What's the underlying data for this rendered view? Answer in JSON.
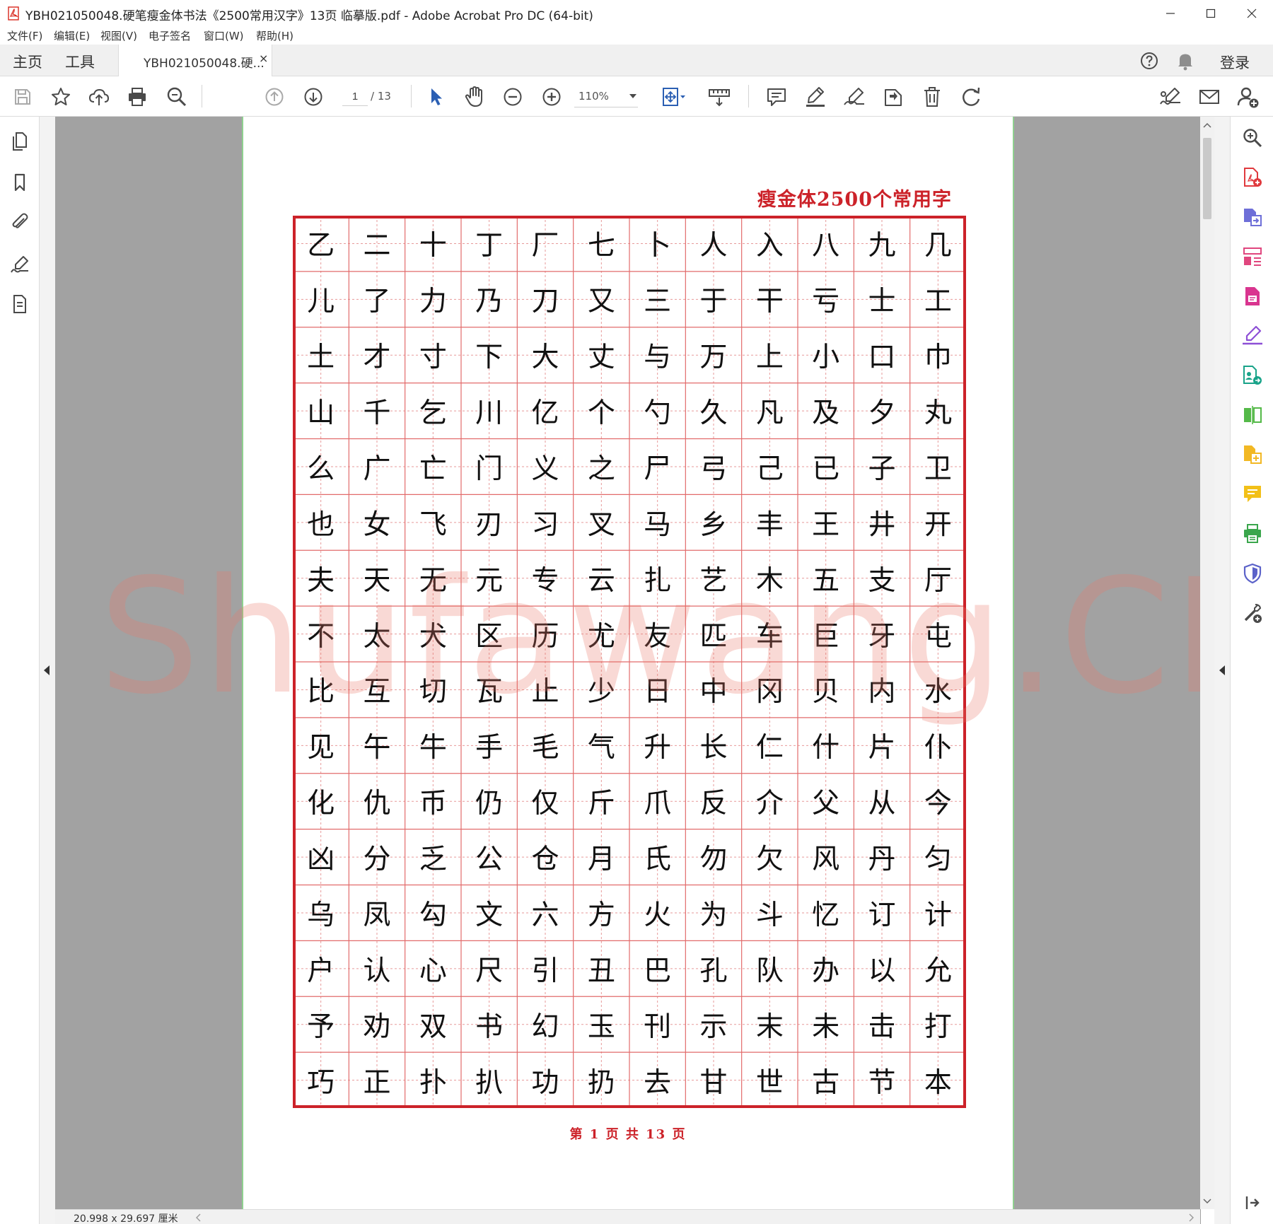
{
  "window": {
    "title": "YBH021050048.硬笔瘦金体书法《2500常用汉字》13页 临摹版.pdf - Adobe Acrobat Pro DC (64-bit)",
    "controls": [
      "minimize",
      "maximize",
      "close"
    ]
  },
  "menu": [
    "文件(F)",
    "编辑(E)",
    "视图(V)",
    "电子签名",
    "窗口(W)",
    "帮助(H)"
  ],
  "tabs": {
    "home": "主页",
    "tools": "工具",
    "document": "YBH021050048.硬...",
    "close": "×",
    "signin": "登录"
  },
  "toolbar": {
    "page_current": "1",
    "page_total": "/ 13",
    "zoom": "110%",
    "icons": [
      "save-icon",
      "star-icon",
      "upload-cloud-icon",
      "print-icon",
      "zoom-search-icon",
      "page-up-icon",
      "page-down-icon",
      "select-arrow-icon",
      "hand-icon",
      "zoom-out-icon",
      "zoom-in-icon",
      "fit-page-icon",
      "measure-icon",
      "comment-icon",
      "highlight-pen-icon",
      "sign-icon",
      "stamp-icon",
      "delete-icon",
      "rotate-icon",
      "fill-sign-icon",
      "email-icon",
      "share-user-icon"
    ]
  },
  "left_rail": [
    "pages-icon",
    "bookmark-icon",
    "attachment-icon",
    "signature-icon",
    "document-icon"
  ],
  "right_rail": [
    "search-zoom-icon",
    "create-pdf-icon",
    "export-pdf-icon",
    "organize-pages-icon",
    "edit-pdf-icon",
    "fill-sign-icon",
    "send-review-icon",
    "compare-icon",
    "combine-icon",
    "comment-icon",
    "print-production-icon",
    "protect-icon",
    "more-tools-icon"
  ],
  "document": {
    "heading": "瘦金体2500个常用字",
    "footer": "第 1 页 共 13 页",
    "watermark": "Shufawang.CN",
    "grid_rows": [
      [
        "乙",
        "二",
        "十",
        "丁",
        "厂",
        "七",
        "卜",
        "人",
        "入",
        "八",
        "九",
        "几"
      ],
      [
        "儿",
        "了",
        "力",
        "乃",
        "刀",
        "又",
        "三",
        "于",
        "干",
        "亏",
        "士",
        "工"
      ],
      [
        "土",
        "才",
        "寸",
        "下",
        "大",
        "丈",
        "与",
        "万",
        "上",
        "小",
        "口",
        "巾"
      ],
      [
        "山",
        "千",
        "乞",
        "川",
        "亿",
        "个",
        "勺",
        "久",
        "凡",
        "及",
        "夕",
        "丸"
      ],
      [
        "么",
        "广",
        "亡",
        "门",
        "义",
        "之",
        "尸",
        "弓",
        "己",
        "已",
        "子",
        "卫"
      ],
      [
        "也",
        "女",
        "飞",
        "刃",
        "习",
        "叉",
        "马",
        "乡",
        "丰",
        "王",
        "井",
        "开"
      ],
      [
        "夫",
        "天",
        "无",
        "元",
        "专",
        "云",
        "扎",
        "艺",
        "木",
        "五",
        "支",
        "厅"
      ],
      [
        "不",
        "太",
        "犬",
        "区",
        "历",
        "尤",
        "友",
        "匹",
        "车",
        "巨",
        "牙",
        "屯"
      ],
      [
        "比",
        "互",
        "切",
        "瓦",
        "止",
        "少",
        "日",
        "中",
        "冈",
        "贝",
        "内",
        "水"
      ],
      [
        "见",
        "午",
        "牛",
        "手",
        "毛",
        "气",
        "升",
        "长",
        "仁",
        "什",
        "片",
        "仆"
      ],
      [
        "化",
        "仇",
        "币",
        "仍",
        "仅",
        "斤",
        "爪",
        "反",
        "介",
        "父",
        "从",
        "今"
      ],
      [
        "凶",
        "分",
        "乏",
        "公",
        "仓",
        "月",
        "氏",
        "勿",
        "欠",
        "风",
        "丹",
        "匀"
      ],
      [
        "乌",
        "凤",
        "勾",
        "文",
        "六",
        "方",
        "火",
        "为",
        "斗",
        "忆",
        "订",
        "计"
      ],
      [
        "户",
        "认",
        "心",
        "尺",
        "引",
        "丑",
        "巴",
        "孔",
        "队",
        "办",
        "以",
        "允"
      ],
      [
        "予",
        "劝",
        "双",
        "书",
        "幻",
        "玉",
        "刊",
        "示",
        "末",
        "未",
        "击",
        "打"
      ],
      [
        "巧",
        "正",
        "扑",
        "扒",
        "功",
        "扔",
        "去",
        "甘",
        "世",
        "古",
        "节",
        "本"
      ]
    ]
  },
  "status": {
    "page_size": "20.998 x 29.697 厘米"
  },
  "colors": {
    "accent_red": "#cc2229",
    "grid_line": "#e26b6b",
    "viewer_bg": "#a2a2a2",
    "page_border_green": "#8fd08f",
    "acrobat_blue": "#2b5fb3"
  }
}
